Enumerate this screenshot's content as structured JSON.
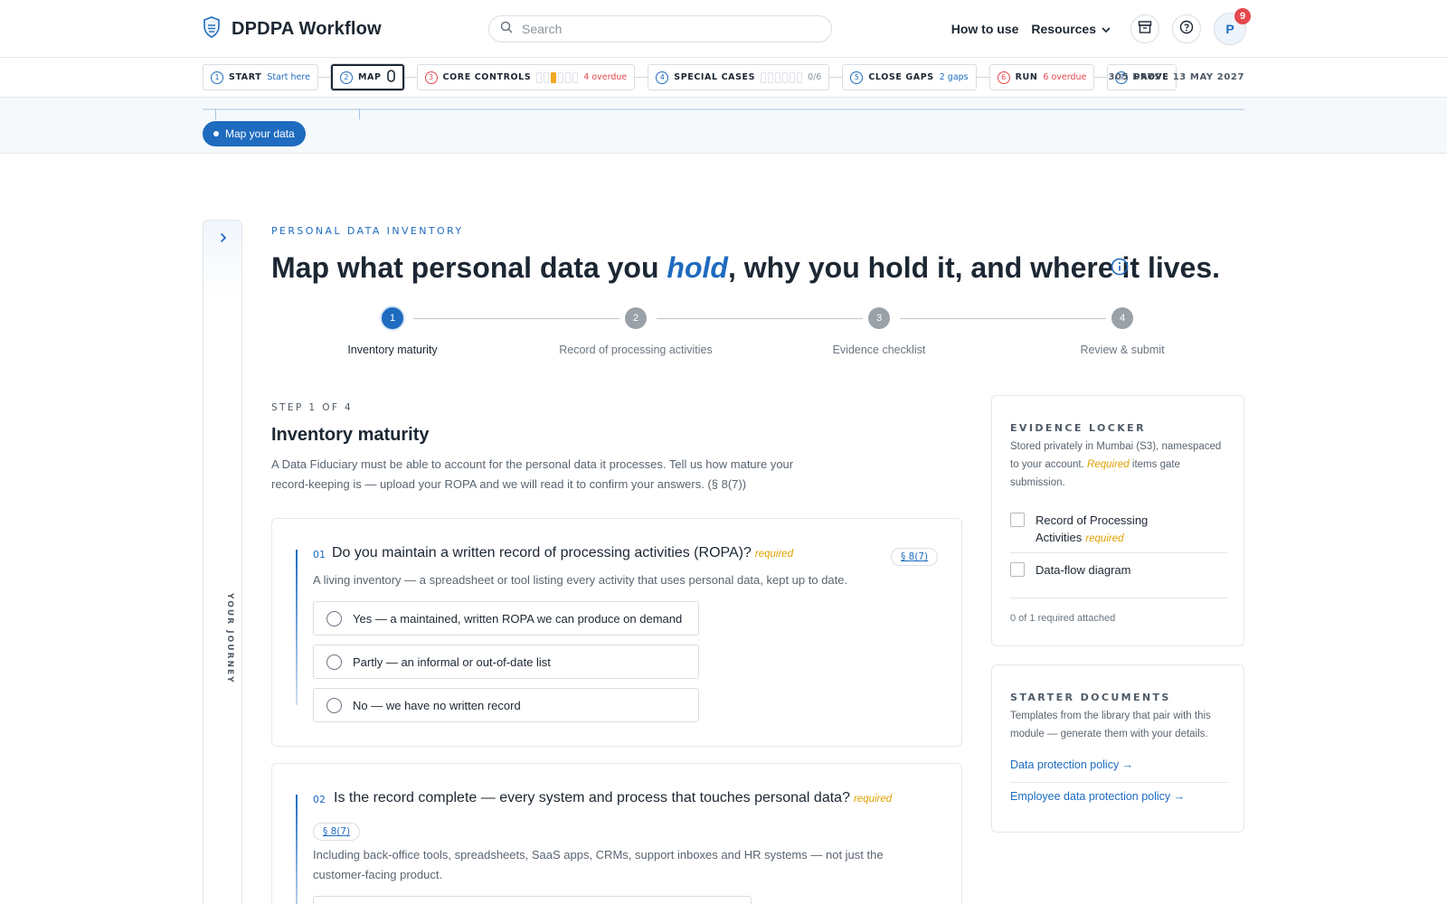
{
  "header": {
    "brand": "DPDPA Workflow",
    "search_placeholder": "Search",
    "how_to_use": "How to use",
    "resources": "Resources",
    "avatar_initial": "P",
    "notification_count": "9"
  },
  "journey": {
    "steps": [
      {
        "num": "1",
        "label": "START",
        "sub": "Start here"
      },
      {
        "num": "2",
        "label": "MAP",
        "sub": ""
      },
      {
        "num": "3",
        "label": "CORE CONTROLS",
        "sub": "4 overdue",
        "progress": 0.167
      },
      {
        "num": "4",
        "label": "SPECIAL CASES",
        "sub": "0/6",
        "progress": 0
      },
      {
        "num": "5",
        "label": "CLOSE GAPS",
        "sub": "2 gaps"
      },
      {
        "num": "6",
        "label": "RUN",
        "sub": "6 overdue"
      },
      {
        "num": "7",
        "label": "PROVE",
        "sub": ""
      }
    ],
    "deadline": "305 DAYS · 13 MAY 2027",
    "current_pill": "Map your data",
    "rail_label": "YOUR JOURNEY"
  },
  "page": {
    "eyebrow": "PERSONAL DATA INVENTORY",
    "title_before": "Map what personal data you ",
    "title_emphasis": "hold",
    "title_after": ", why you hold it, and where it lives."
  },
  "stepper": [
    {
      "num": "1",
      "label": "Inventory maturity"
    },
    {
      "num": "2",
      "label": "Record of processing activities"
    },
    {
      "num": "3",
      "label": "Evidence checklist"
    },
    {
      "num": "4",
      "label": "Review & submit"
    }
  ],
  "step": {
    "eyebrow": "STEP 1 OF 4",
    "title": "Inventory maturity",
    "description": "A Data Fiduciary must be able to account for the personal data it processes. Tell us how mature your record-keeping is — upload your ROPA and we will read it to confirm your answers. (§ 8(7))"
  },
  "questions": [
    {
      "num": "01",
      "title": "Do you maintain a written record of processing activities (ROPA)?",
      "required": "required",
      "ref": "§ 8(7)",
      "help": "A living inventory — a spreadsheet or tool listing every activity that uses personal data, kept up to date.",
      "options": [
        "Yes — a maintained, written ROPA we can produce on demand",
        "Partly — an informal or out-of-date list",
        "No — we have no written record"
      ]
    },
    {
      "num": "02",
      "title": "Is the record complete — every system and process that touches personal data?",
      "required": "required",
      "ref": "§ 8(7)",
      "help": "Including back-office tools, spreadsheets, SaaS apps, CRMs, support inboxes and HR systems — not just the customer-facing product."
    }
  ],
  "evidence_locker": {
    "eyebrow": "EVIDENCE LOCKER",
    "desc_before": "Stored privately in Mumbai (S3), namespaced to your account. ",
    "desc_required": "Required",
    "desc_after": " items gate submission.",
    "items": [
      {
        "label": "Record of Processing Activities",
        "required": "required"
      },
      {
        "label": "Data-flow diagram",
        "required": ""
      }
    ],
    "footer": "0 of 1 required attached"
  },
  "starter_documents": {
    "eyebrow": "STARTER DOCUMENTS",
    "desc": "Templates from the library that pair with this module — generate them with your details.",
    "links": [
      "Data protection policy →",
      "Employee data protection policy →"
    ]
  },
  "colors": {
    "accent": "#1e6bbf",
    "danger": "#e5484d",
    "warning": "#f5a623",
    "required": "#e0a100"
  }
}
